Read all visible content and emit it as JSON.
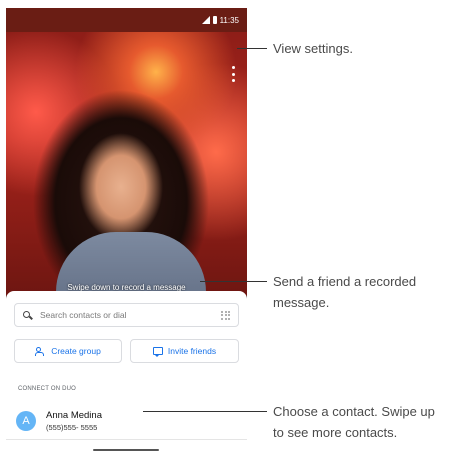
{
  "status_bar": {
    "time": "11:35"
  },
  "camera": {
    "swipe_hint": "Swipe down to record a message"
  },
  "search": {
    "placeholder": "Search contacts or dial"
  },
  "actions": {
    "create_group": "Create group",
    "invite_friends": "Invite friends"
  },
  "section": {
    "label": "CONNECT ON DUO"
  },
  "contact": {
    "initial": "A",
    "name": "Anna Medina",
    "phone": "(555)555- 5555"
  },
  "callouts": {
    "settings": "View settings.",
    "recorded_line1": "Send a friend a recorded",
    "recorded_line2": "message.",
    "contact_line1": "Choose a contact. Swipe up",
    "contact_line2": "to see more contacts."
  },
  "colors": {
    "accent": "#1a73e8",
    "avatar": "#64b5f6",
    "status_bar": "#6a1d14"
  }
}
